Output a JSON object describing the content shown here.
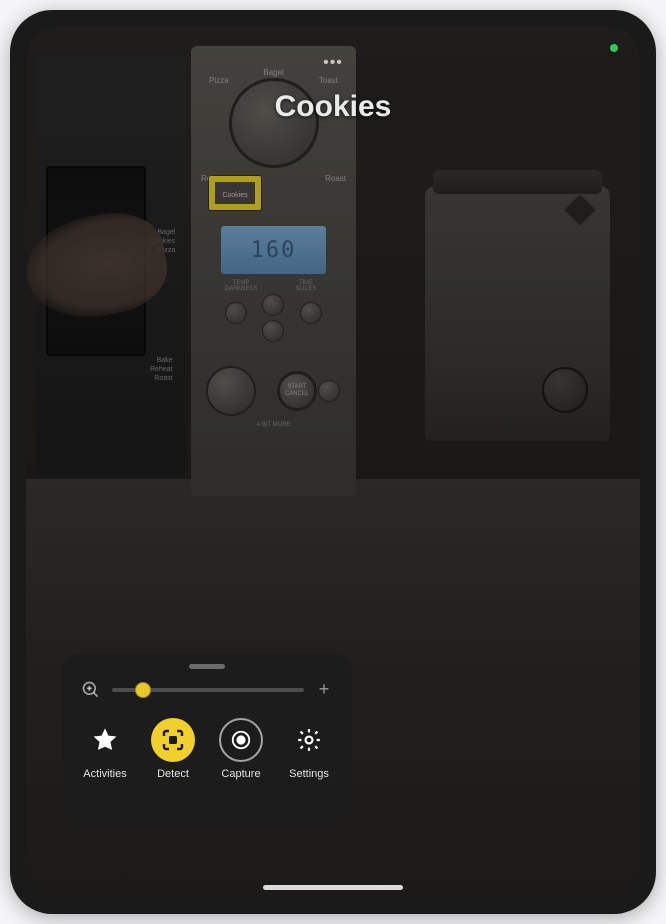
{
  "status": {
    "camera_indicator": true
  },
  "detection": {
    "title": "Cookies",
    "highlight_color": "#e8d428"
  },
  "scene": {
    "lcd_value": "160",
    "dial_labels": {
      "tl": "Pizza",
      "tr": "Toast",
      "ml": "Reheat",
      "mr": "Roast",
      "t_bagel": "Bagel"
    },
    "button_cookies": "Cookies",
    "lbl_temp": "TEMP",
    "lbl_time": "TIME",
    "lbl_slices": "SLICES",
    "lbl_darkness": "DARKNESS",
    "start_button": "START\nCANCEL",
    "bottom_caption": "A BIT MORE",
    "side_labels_top": "Bagel\nCookies\nPizza",
    "side_labels_bottom": "Bake\nReheat\nRoast"
  },
  "sheet": {
    "zoom": {
      "value_pct": 16,
      "thumb_color": "#e8c828"
    },
    "modes": [
      {
        "id": "activities",
        "label": "Activities",
        "icon": "star-icon",
        "active": false
      },
      {
        "id": "detect",
        "label": "Detect",
        "icon": "detect-icon",
        "active": true
      },
      {
        "id": "capture",
        "label": "Capture",
        "icon": "capture-icon",
        "active": false
      },
      {
        "id": "settings",
        "label": "Settings",
        "icon": "gear-icon",
        "active": false
      }
    ]
  }
}
